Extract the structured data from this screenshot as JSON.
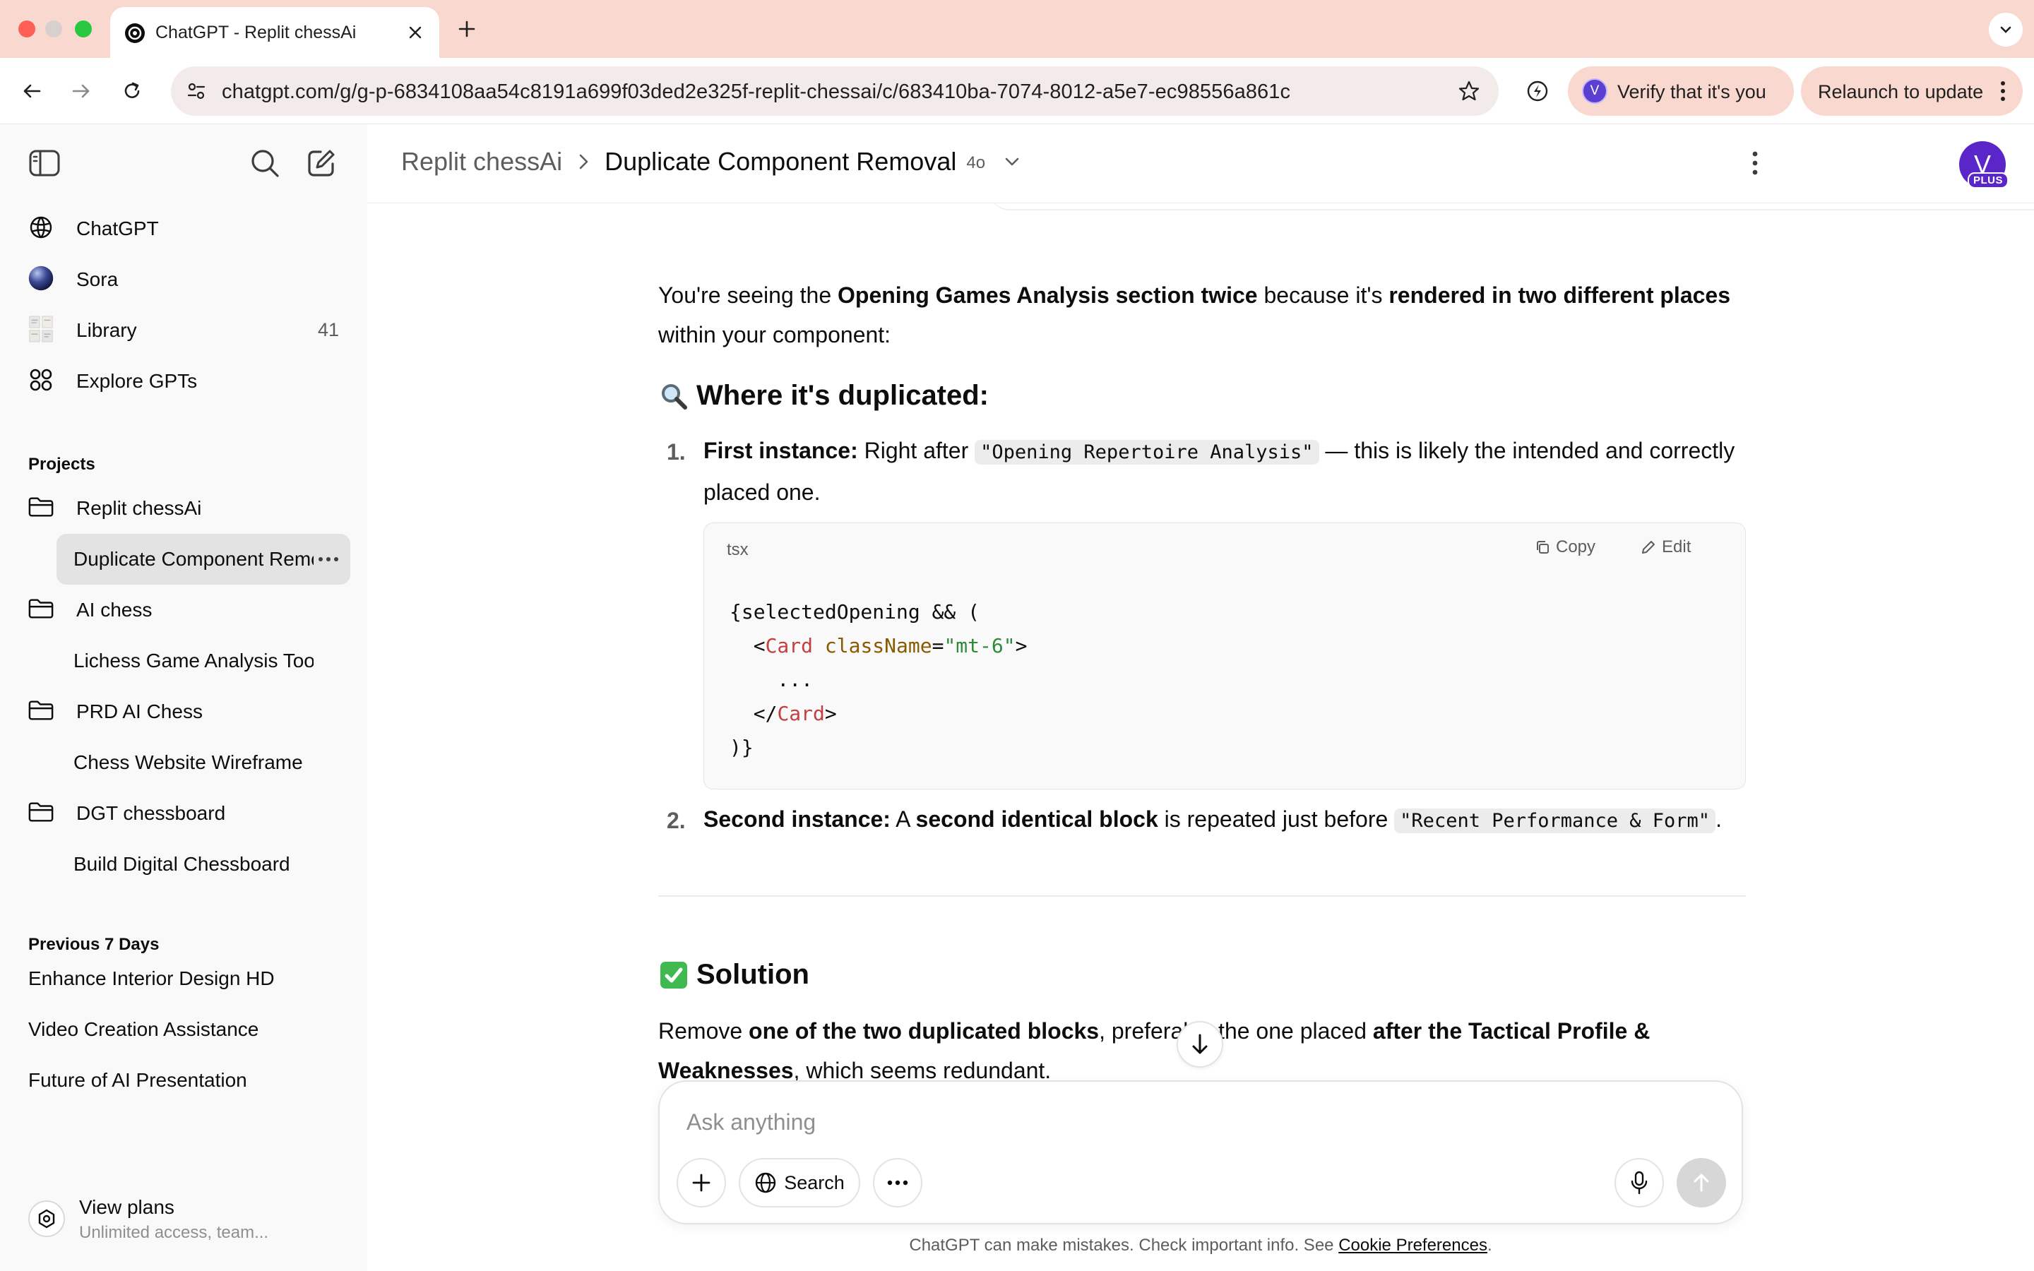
{
  "browser": {
    "tab_title": "ChatGPT - Replit chessAi",
    "url": "chatgpt.com/g/g-p-6834108aa54c8191a699f03ded2e325f-replit-chessai/c/683410ba-7074-8012-a5e7-ec98556a861c",
    "verify_avatar_letter": "V",
    "verify_label": "Verify that it's you",
    "relaunch_label": "Relaunch to update"
  },
  "sidebar": {
    "nav": [
      {
        "label": "ChatGPT",
        "icon": "openai-logo-icon"
      },
      {
        "label": "Sora",
        "icon": "sora-icon"
      },
      {
        "label": "Library",
        "icon": "library-icon",
        "count": "41"
      },
      {
        "label": "Explore GPTs",
        "icon": "grid-icon"
      }
    ],
    "projects_heading": "Projects",
    "projects": [
      {
        "label": "Replit chessAi",
        "chats": [
          "Duplicate Component Removal"
        ]
      },
      {
        "label": "AI chess",
        "chats": [
          "Lichess Game Analysis Tool"
        ]
      },
      {
        "label": "PRD AI Chess",
        "chats": [
          "Chess Website Wireframe"
        ]
      },
      {
        "label": "DGT chessboard",
        "chats": [
          "Build Digital Chessboard"
        ]
      }
    ],
    "recent_heading": "Previous 7 Days",
    "recent": [
      "Enhance Interior Design HD",
      "Video Creation Assistance",
      "Future of AI Presentation"
    ],
    "plans_title": "View plans",
    "plans_sub": "Unlimited access, team..."
  },
  "header": {
    "project": "Replit chessAi",
    "title": "Duplicate Component Removal",
    "model": "4o",
    "avatar_letter": "V",
    "avatar_badge": "PLUS"
  },
  "message": {
    "intro_1": "You're seeing the ",
    "intro_b1": "Opening Games Analysis section twice",
    "intro_2": " because it's ",
    "intro_b2": "rendered in two different places",
    "intro_3": " within your component:",
    "heading_1": "Where it's duplicated:",
    "item1_num": "1.",
    "item1_b": "First instance:",
    "item1_a": " Right after ",
    "item1_code": "\"Opening Repertoire Analysis\"",
    "item1_c": " — this is likely the intended and correctly placed one.",
    "code_lang": "tsx",
    "code_copy": "Copy",
    "code_edit": "Edit",
    "code_line1": "{selectedOpening && (",
    "code_l2_a": "  <",
    "code_l2_tag": "Card",
    "code_l2_attr": " className",
    "code_l2_eq": "=",
    "code_l2_str": "\"mt-6\"",
    "code_l2_end": ">",
    "code_line3": "    ...",
    "code_l4_a": "  </",
    "code_l4_tag": "Card",
    "code_l4_end": ">",
    "code_line5": ")}",
    "item2_num": "2.",
    "item2_b": "Second instance:",
    "item2_a": " A ",
    "item2_b2": "second identical block",
    "item2_c": " is repeated just before ",
    "item2_code": "\"Recent Performance & Form\"",
    "item2_d": ".",
    "heading_2": "Solution",
    "sol_a": "Remove ",
    "sol_b": "one of the two duplicated blocks",
    "sol_c": ", preferably the one placed ",
    "sol_d": "after the Tactical Profile & Weaknesses",
    "sol_e": ", which seems redundant."
  },
  "composer": {
    "placeholder": "Ask anything",
    "search_label": "Search"
  },
  "footer": {
    "disclaimer": "ChatGPT can make mistakes. Check important info. See ",
    "link": "Cookie Preferences",
    "end": "."
  },
  "colors": {
    "tabbar": "#f9d9cf",
    "sidebar": "#f9f9f9",
    "avatar": "#5b26c9",
    "check_emoji": "#3fb950"
  }
}
